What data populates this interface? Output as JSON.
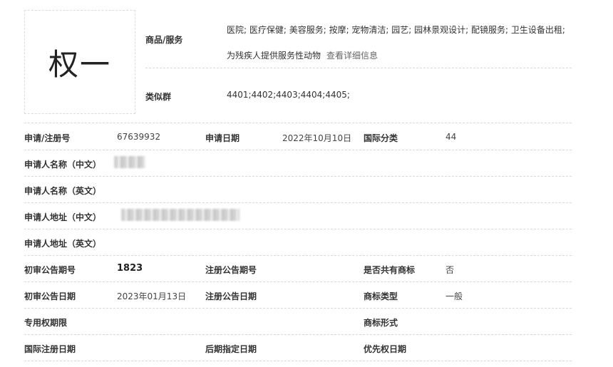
{
  "logo": {
    "text": "权一"
  },
  "goods": {
    "label": "商品/服务",
    "text": "医院; 医疗保健; 美容服务; 按摩; 宠物清洁; 园艺; 园林景观设计; 配镜服务; 卫生设备出租; 为残疾人提供服务性动物",
    "detail_link": "查看详细信息"
  },
  "similar": {
    "label": "类似群",
    "value": "4401;4402;4403;4404;4405;"
  },
  "rows": [
    {
      "cells": [
        {
          "label": "申请/注册号",
          "value": "67639932"
        },
        {
          "label": "申请日期",
          "value": "2022年10月10日"
        },
        {
          "label": "国际分类",
          "value": "44"
        }
      ]
    },
    {
      "cells": [
        {
          "label": "申请人名称（中文）"
        }
      ]
    },
    {
      "cells": [
        {
          "label": "申请人名称（英文）"
        }
      ]
    },
    {
      "cells": [
        {
          "label": "申请人地址（中文）"
        }
      ]
    },
    {
      "cells": [
        {
          "label": "申请人地址（英文）"
        }
      ]
    },
    {
      "cells": [
        {
          "label": "初审公告期号",
          "value": "1823"
        },
        {
          "label": "注册公告期号",
          "value": ""
        },
        {
          "label": "是否共有商标",
          "value": "否"
        }
      ]
    },
    {
      "cells": [
        {
          "label": "初审公告日期",
          "value": "2023年01月13日"
        },
        {
          "label": "注册公告日期",
          "value": ""
        },
        {
          "label": "商标类型",
          "value": "一般"
        }
      ]
    },
    {
      "cells": [
        {
          "label": "专用权期限",
          "value": ""
        },
        {
          "label": "商标形式",
          "value": ""
        }
      ]
    },
    {
      "cells": [
        {
          "label": "国际注册日期",
          "value": ""
        },
        {
          "label": "后期指定日期",
          "value": ""
        },
        {
          "label": "优先权日期",
          "value": ""
        }
      ]
    }
  ]
}
